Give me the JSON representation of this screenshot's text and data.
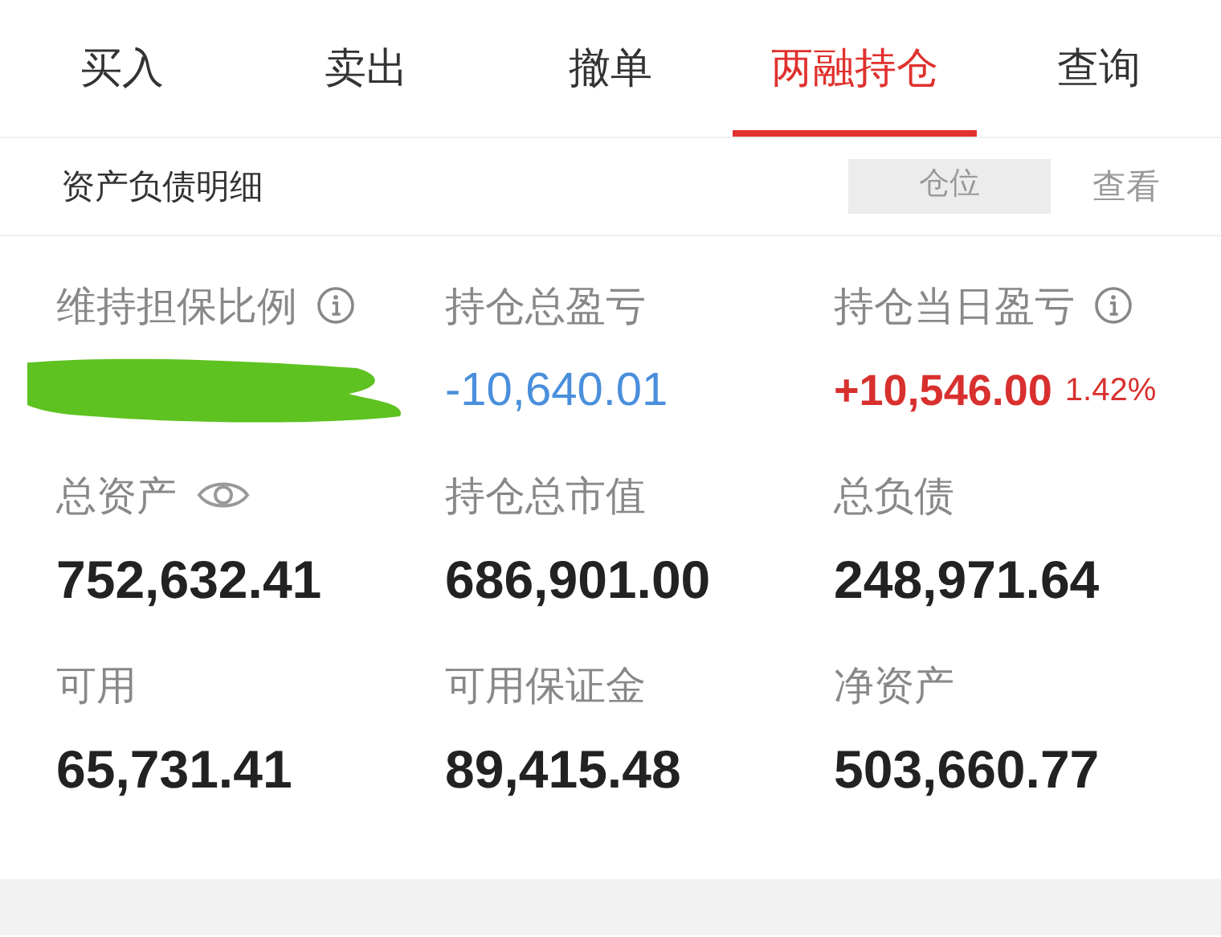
{
  "tabs": [
    {
      "label": "买入",
      "selected": false
    },
    {
      "label": "卖出",
      "selected": false
    },
    {
      "label": "撤单",
      "selected": false
    },
    {
      "label": "两融持仓",
      "selected": true
    },
    {
      "label": "查询",
      "selected": false
    }
  ],
  "section": {
    "title": "资产负债明细",
    "toggle": "仓位",
    "link": "查看"
  },
  "metrics": [
    {
      "label": "维持担保比例",
      "kind": "redacted"
    },
    {
      "label": "持仓总盈亏",
      "kind": "loss",
      "value": "-10,640.01"
    },
    {
      "label": "持仓当日盈亏",
      "kind": "gain",
      "value": "+10,546.00",
      "percent": "1.42%"
    },
    {
      "label": "总资产",
      "kind": "plain",
      "value": "752,632.41"
    },
    {
      "label": "持仓总市值",
      "kind": "plain",
      "value": "686,901.00"
    },
    {
      "label": "总负债",
      "kind": "plain",
      "value": "248,971.64"
    },
    {
      "label": "可用",
      "kind": "plain",
      "value": "65,731.41"
    },
    {
      "label": "可用保证金",
      "kind": "plain",
      "value": "89,415.48"
    },
    {
      "label": "净资产",
      "kind": "plain",
      "value": "503,660.77"
    }
  ]
}
